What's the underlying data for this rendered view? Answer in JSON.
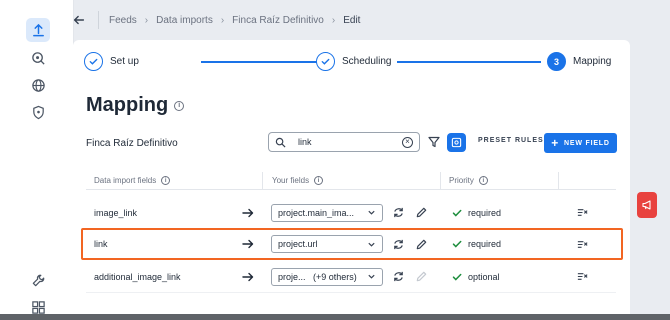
{
  "breadcrumb": {
    "items": [
      "Feeds",
      "Data imports",
      "Finca Raíz Definitivo"
    ],
    "current": "Edit"
  },
  "stepper": {
    "steps": [
      {
        "label": "Set up",
        "state": "done"
      },
      {
        "label": "Scheduling",
        "state": "done"
      },
      {
        "label": "Mapping",
        "state": "active",
        "number": "3"
      }
    ]
  },
  "page": {
    "title": "Mapping",
    "feed_name": "Finca Raíz Definitivo"
  },
  "toolbar": {
    "search_value": "link",
    "preset_rules_label": "PRESET RULES",
    "new_field_label": "NEW FIELD"
  },
  "table": {
    "headers": {
      "data_import_fields": "Data import fields",
      "your_fields": "Your fields",
      "priority": "Priority"
    },
    "rows": [
      {
        "import_field": "image_link",
        "your_field": "project.main_ima...",
        "priority": "required",
        "highlighted": false
      },
      {
        "import_field": "link",
        "your_field": "project.url",
        "priority": "required",
        "highlighted": true
      },
      {
        "import_field": "additional_image_link",
        "your_field": "proje...   (+9 others)",
        "priority": "optional",
        "highlighted": false
      }
    ]
  },
  "colors": {
    "accent": "#1a73e8",
    "highlight": "#f26522",
    "success": "#1e8e3e",
    "feedback": "#e8423f"
  },
  "icons": {
    "rail": [
      "upload-icon",
      "target-search-icon",
      "globe-icon",
      "shield-icon",
      "wrench-icon",
      "grid-icon"
    ]
  }
}
